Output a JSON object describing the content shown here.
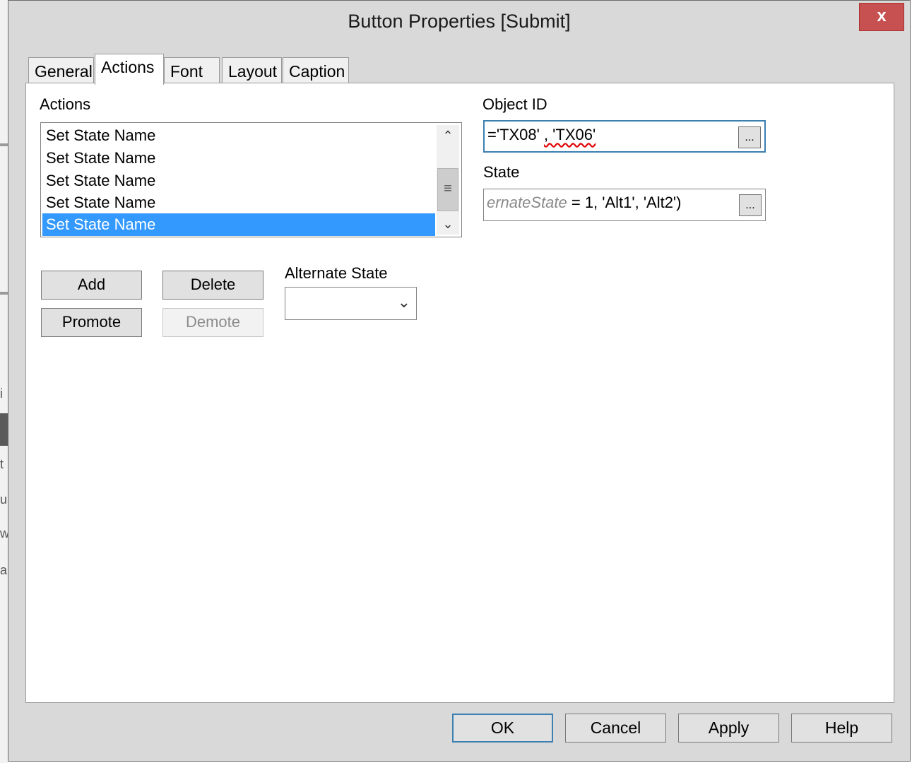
{
  "window": {
    "title": "Button Properties [Submit]",
    "close_glyph": "x"
  },
  "tabs": [
    {
      "label": "General",
      "active": false
    },
    {
      "label": "Actions",
      "active": true
    },
    {
      "label": "Font",
      "active": false
    },
    {
      "label": "Layout",
      "active": false
    },
    {
      "label": "Caption",
      "active": false
    }
  ],
  "actions": {
    "label": "Actions",
    "items": [
      "Set State Name",
      "Set State Name",
      "Set State Name",
      "Set State Name",
      "Set State Name"
    ],
    "selected_index": 4,
    "buttons": {
      "add": "Add",
      "delete": "Delete",
      "promote": "Promote",
      "demote": "Demote"
    }
  },
  "alternate_state": {
    "label": "Alternate State",
    "value": ""
  },
  "object_id": {
    "label": "Object ID",
    "value_prefix": "='TX08' ",
    "value_misspelled": ", 'TX06'",
    "button": "..."
  },
  "state": {
    "label": "State",
    "value_italic": "ernateState",
    "value_rest": " = 1, 'Alt1', 'Alt2')",
    "button": "..."
  },
  "footer": {
    "ok": "OK",
    "cancel": "Cancel",
    "apply": "Apply",
    "help": "Help"
  },
  "background_fragments": [
    "i",
    "t",
    "u",
    "w",
    "a"
  ]
}
